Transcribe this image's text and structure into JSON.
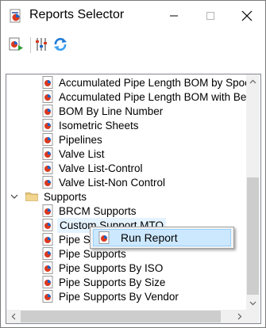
{
  "window": {
    "title": "Reports Selector"
  },
  "toolbar": {
    "buttons": [
      {
        "name": "run-report-icon"
      },
      {
        "name": "filter-settings-icon"
      },
      {
        "name": "refresh-icon"
      }
    ]
  },
  "tree": {
    "items": [
      {
        "label": "Accumulated Pipe Length BOM by Spool",
        "level": 1,
        "type": "report"
      },
      {
        "label": "Accumulated Pipe Length BOM with Bend",
        "level": 1,
        "type": "report"
      },
      {
        "label": "BOM By Line Number",
        "level": 1,
        "type": "report"
      },
      {
        "label": "Isometric Sheets",
        "level": 1,
        "type": "report"
      },
      {
        "label": "Pipelines",
        "level": 1,
        "type": "report"
      },
      {
        "label": "Valve List",
        "level": 1,
        "type": "report"
      },
      {
        "label": "Valve List-Control",
        "level": 1,
        "type": "report"
      },
      {
        "label": "Valve List-Non Control",
        "level": 1,
        "type": "report"
      },
      {
        "label": "Supports",
        "level": 0,
        "type": "folder",
        "expanded": true
      },
      {
        "label": "BRCM Supports",
        "level": 1,
        "type": "report"
      },
      {
        "label": "Custom Support MTO",
        "level": 1,
        "type": "report",
        "selected": true
      },
      {
        "label": "Pipe Supports",
        "level": 1,
        "type": "report"
      },
      {
        "label": "Pipe Supports",
        "level": 1,
        "type": "report"
      },
      {
        "label": "Pipe Supports By ISO",
        "level": 1,
        "type": "report"
      },
      {
        "label": "Pipe Supports By Size",
        "level": 1,
        "type": "report"
      },
      {
        "label": "Pipe Supports By Vendor",
        "level": 1,
        "type": "report"
      }
    ]
  },
  "context_menu": {
    "items": [
      {
        "label": "Run Report",
        "highlighted": true
      }
    ]
  },
  "colors": {
    "selection": "#e5f3ff",
    "menu_highlight": "#cce8ff",
    "report_icon_red": "#d93a1f",
    "report_icon_blue": "#1e63c8"
  }
}
